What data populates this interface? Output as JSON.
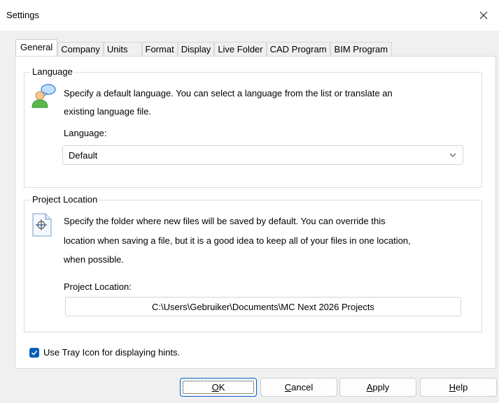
{
  "window": {
    "title": "Settings"
  },
  "tabs": [
    {
      "label": "General",
      "active": true
    },
    {
      "label": "Company"
    },
    {
      "label": "Units"
    },
    {
      "label": "Format"
    },
    {
      "label": "Display"
    },
    {
      "label": "Live Folder"
    },
    {
      "label": "CAD Program"
    },
    {
      "label": "BIM Program"
    }
  ],
  "language_group": {
    "title": "Language",
    "description_line1": "Specify a default language. You can select a language from the list or translate an",
    "description_line2": "existing language file.",
    "field_label": "Language:",
    "selected_value": "Default"
  },
  "project_group": {
    "title": "Project Location",
    "description_line1": "Specify the folder where new files will be saved by default. You can override this",
    "description_line2": "location when saving a file, but it is a good idea to keep all of your files in one location,",
    "description_line3": "when possible.",
    "field_label": "Project Location:",
    "path_value": "C:\\Users\\Gebruiker\\Documents\\MC Next 2026 Projects"
  },
  "tray_icon": {
    "label": "Use Tray Icon for displaying hints.",
    "checked": true
  },
  "buttons": {
    "ok": {
      "mnemonic": "O",
      "rest": "K"
    },
    "cancel": {
      "mnemonic": "C",
      "rest": "ancel"
    },
    "apply": {
      "mnemonic": "A",
      "rest": "pply"
    },
    "help": {
      "mnemonic": "H",
      "rest": "elp"
    }
  },
  "colors": {
    "accent": "#005fb8",
    "window_bg": "#f0f0f0",
    "panel_bg": "#ffffff"
  },
  "icons": {
    "close": "close-icon",
    "language": "users-speech-icon",
    "project": "folder-target-icon",
    "dropdown": "chevron-down-icon",
    "check": "checkmark-icon"
  }
}
